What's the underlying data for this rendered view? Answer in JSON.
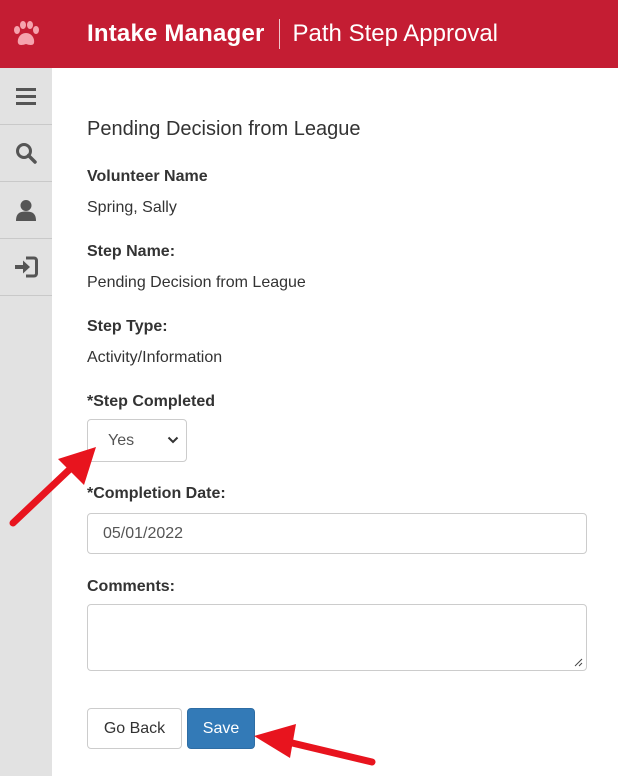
{
  "header": {
    "app_title": "Intake Manager",
    "page_heading": "Path Step Approval",
    "logo_icon": "paw-print-icon",
    "background_color": "#c41d33"
  },
  "sidebar": {
    "items": [
      {
        "name": "menu",
        "icon": "hamburger-menu-icon"
      },
      {
        "name": "search",
        "icon": "search-icon"
      },
      {
        "name": "profile",
        "icon": "user-icon"
      },
      {
        "name": "logout",
        "icon": "sign-out-icon"
      }
    ]
  },
  "form": {
    "section_title": "Pending Decision from League",
    "volunteer_name_label": "Volunteer Name",
    "volunteer_name_value": "Spring, Sally",
    "step_name_label": "Step Name:",
    "step_name_value": "Pending Decision from League",
    "step_type_label": "Step Type:",
    "step_type_value": "Activity/Information",
    "step_completed_label": "*Step Completed",
    "step_completed_value": "Yes",
    "completion_date_label": "*Completion Date:",
    "completion_date_value": "05/01/2022",
    "comments_label": "Comments:",
    "comments_value": ""
  },
  "buttons": {
    "back_label": "Go Back",
    "save_label": "Save",
    "save_color": "#337ab7"
  },
  "annotations": {
    "arrow_color": "#e8141e"
  }
}
